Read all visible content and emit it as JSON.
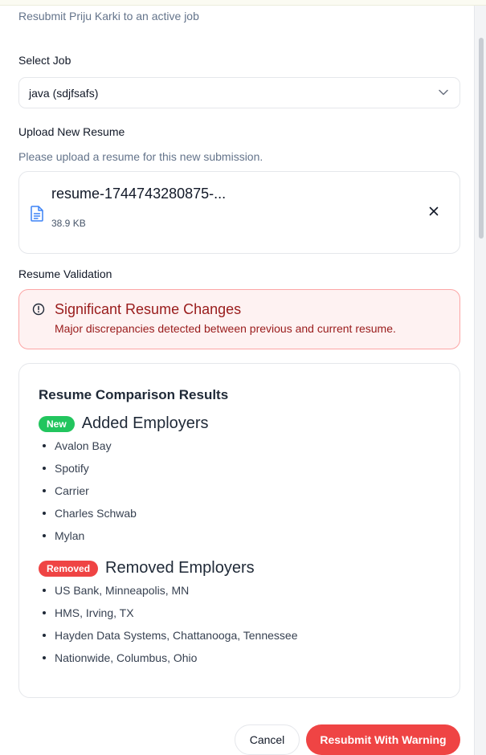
{
  "dialog": {
    "subtitle": "Resubmit Priju Karki to an active job"
  },
  "select_job": {
    "label": "Select Job",
    "value": "java (sdjfsafs)",
    "icon": "chevron-down-icon"
  },
  "upload": {
    "label": "Upload New Resume",
    "help": "Please upload a resume for this new submission.",
    "file_name": "resume-1744743280875-...",
    "file_size": "38.9 KB",
    "file_icon": "file-text-icon",
    "remove_icon": "close-icon"
  },
  "validation": {
    "label": "Resume Validation",
    "alert_title": "Significant Resume Changes",
    "alert_description": "Major discrepancies detected between previous and current resume.",
    "alert_icon": "alert-circle-icon"
  },
  "comparison": {
    "title": "Resume Comparison Results",
    "added": {
      "badge": "New",
      "title": "Added Employers",
      "items": [
        "Avalon Bay",
        "Spotify",
        "Carrier",
        "Charles Schwab",
        "Mylan"
      ]
    },
    "removed": {
      "badge": "Removed",
      "title": "Removed Employers",
      "items": [
        "US Bank, Minneapolis, MN",
        "HMS, Irving, TX",
        "Hayden Data Systems, Chattanooga, Tennessee",
        "Nationwide, Columbus, Ohio"
      ]
    }
  },
  "actions": {
    "cancel": "Cancel",
    "submit": "Resubmit With Warning"
  },
  "colors": {
    "danger": "#ef4444",
    "success": "#22c55e",
    "alert_text": "#991b1b",
    "alert_bg": "#fef2f2",
    "file_icon": "#3b82f6"
  }
}
